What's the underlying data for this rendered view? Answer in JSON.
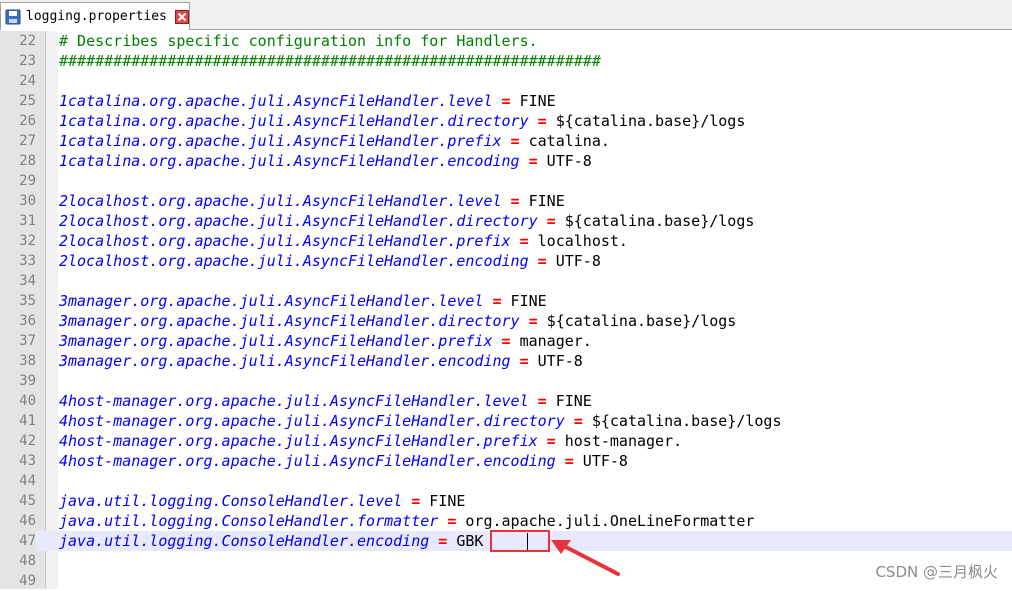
{
  "tab": {
    "label": "logging.properties"
  },
  "lines": [
    {
      "no": "22",
      "segments": [
        {
          "t": "c",
          "text": "# Describes specific configuration info for Handlers."
        }
      ]
    },
    {
      "no": "23",
      "segments": [
        {
          "t": "c",
          "text": "############################################################"
        }
      ]
    },
    {
      "no": "24",
      "segments": []
    },
    {
      "no": "25",
      "segments": [
        {
          "t": "k",
          "text": "1catalina.org.apache.juli.AsyncFileHandler.level"
        },
        {
          "t": "v",
          "text": " "
        },
        {
          "t": "o",
          "text": "="
        },
        {
          "t": "v",
          "text": " FINE"
        }
      ]
    },
    {
      "no": "26",
      "segments": [
        {
          "t": "k",
          "text": "1catalina.org.apache.juli.AsyncFileHandler.directory"
        },
        {
          "t": "v",
          "text": " "
        },
        {
          "t": "o",
          "text": "="
        },
        {
          "t": "v",
          "text": " ${catalina.base}/logs"
        }
      ]
    },
    {
      "no": "27",
      "segments": [
        {
          "t": "k",
          "text": "1catalina.org.apache.juli.AsyncFileHandler.prefix"
        },
        {
          "t": "v",
          "text": " "
        },
        {
          "t": "o",
          "text": "="
        },
        {
          "t": "v",
          "text": " catalina."
        }
      ]
    },
    {
      "no": "28",
      "segments": [
        {
          "t": "k",
          "text": "1catalina.org.apache.juli.AsyncFileHandler.encoding"
        },
        {
          "t": "v",
          "text": " "
        },
        {
          "t": "o",
          "text": "="
        },
        {
          "t": "v",
          "text": " UTF-8"
        }
      ]
    },
    {
      "no": "29",
      "segments": []
    },
    {
      "no": "30",
      "segments": [
        {
          "t": "k",
          "text": "2localhost.org.apache.juli.AsyncFileHandler.level"
        },
        {
          "t": "v",
          "text": " "
        },
        {
          "t": "o",
          "text": "="
        },
        {
          "t": "v",
          "text": " FINE"
        }
      ]
    },
    {
      "no": "31",
      "segments": [
        {
          "t": "k",
          "text": "2localhost.org.apache.juli.AsyncFileHandler.directory"
        },
        {
          "t": "v",
          "text": " "
        },
        {
          "t": "o",
          "text": "="
        },
        {
          "t": "v",
          "text": " ${catalina.base}/logs"
        }
      ]
    },
    {
      "no": "32",
      "segments": [
        {
          "t": "k",
          "text": "2localhost.org.apache.juli.AsyncFileHandler.prefix"
        },
        {
          "t": "v",
          "text": " "
        },
        {
          "t": "o",
          "text": "="
        },
        {
          "t": "v",
          "text": " localhost."
        }
      ]
    },
    {
      "no": "33",
      "segments": [
        {
          "t": "k",
          "text": "2localhost.org.apache.juli.AsyncFileHandler.encoding"
        },
        {
          "t": "v",
          "text": " "
        },
        {
          "t": "o",
          "text": "="
        },
        {
          "t": "v",
          "text": " UTF-8"
        }
      ]
    },
    {
      "no": "34",
      "segments": []
    },
    {
      "no": "35",
      "segments": [
        {
          "t": "k",
          "text": "3manager.org.apache.juli.AsyncFileHandler.level"
        },
        {
          "t": "v",
          "text": " "
        },
        {
          "t": "o",
          "text": "="
        },
        {
          "t": "v",
          "text": " FINE"
        }
      ]
    },
    {
      "no": "36",
      "segments": [
        {
          "t": "k",
          "text": "3manager.org.apache.juli.AsyncFileHandler.directory"
        },
        {
          "t": "v",
          "text": " "
        },
        {
          "t": "o",
          "text": "="
        },
        {
          "t": "v",
          "text": " ${catalina.base}/logs"
        }
      ]
    },
    {
      "no": "37",
      "segments": [
        {
          "t": "k",
          "text": "3manager.org.apache.juli.AsyncFileHandler.prefix"
        },
        {
          "t": "v",
          "text": " "
        },
        {
          "t": "o",
          "text": "="
        },
        {
          "t": "v",
          "text": " manager."
        }
      ]
    },
    {
      "no": "38",
      "segments": [
        {
          "t": "k",
          "text": "3manager.org.apache.juli.AsyncFileHandler.encoding"
        },
        {
          "t": "v",
          "text": " "
        },
        {
          "t": "o",
          "text": "="
        },
        {
          "t": "v",
          "text": " UTF-8"
        }
      ]
    },
    {
      "no": "39",
      "segments": []
    },
    {
      "no": "40",
      "segments": [
        {
          "t": "k",
          "text": "4host-manager.org.apache.juli.AsyncFileHandler.level"
        },
        {
          "t": "v",
          "text": " "
        },
        {
          "t": "o",
          "text": "="
        },
        {
          "t": "v",
          "text": " FINE"
        }
      ]
    },
    {
      "no": "41",
      "segments": [
        {
          "t": "k",
          "text": "4host-manager.org.apache.juli.AsyncFileHandler.directory"
        },
        {
          "t": "v",
          "text": " "
        },
        {
          "t": "o",
          "text": "="
        },
        {
          "t": "v",
          "text": " ${catalina.base}/logs"
        }
      ]
    },
    {
      "no": "42",
      "segments": [
        {
          "t": "k",
          "text": "4host-manager.org.apache.juli.AsyncFileHandler.prefix"
        },
        {
          "t": "v",
          "text": " "
        },
        {
          "t": "o",
          "text": "="
        },
        {
          "t": "v",
          "text": " host-manager."
        }
      ]
    },
    {
      "no": "43",
      "segments": [
        {
          "t": "k",
          "text": "4host-manager.org.apache.juli.AsyncFileHandler.encoding"
        },
        {
          "t": "v",
          "text": " "
        },
        {
          "t": "o",
          "text": "="
        },
        {
          "t": "v",
          "text": " UTF-8"
        }
      ]
    },
    {
      "no": "44",
      "segments": []
    },
    {
      "no": "45",
      "segments": [
        {
          "t": "k",
          "text": "java.util.logging.ConsoleHandler.level"
        },
        {
          "t": "v",
          "text": " "
        },
        {
          "t": "o",
          "text": "="
        },
        {
          "t": "v",
          "text": " FINE"
        }
      ]
    },
    {
      "no": "46",
      "segments": [
        {
          "t": "k",
          "text": "java.util.logging.ConsoleHandler.formatter"
        },
        {
          "t": "v",
          "text": " "
        },
        {
          "t": "o",
          "text": "="
        },
        {
          "t": "v",
          "text": " org.apache.juli.OneLineFormatter"
        }
      ]
    },
    {
      "no": "47",
      "current": true,
      "segments": [
        {
          "t": "k",
          "text": "java.util.logging.ConsoleHandler.encoding"
        },
        {
          "t": "v",
          "text": " "
        },
        {
          "t": "o",
          "text": "="
        },
        {
          "t": "v",
          "text": " GBK"
        }
      ]
    },
    {
      "no": "48",
      "segments": []
    },
    {
      "no": "49",
      "segments": []
    }
  ],
  "watermark": "CSDN @三月枫火",
  "colors": {
    "comment": "#008000",
    "key": "#0000ff",
    "operator": "#ff0000",
    "value": "#000000",
    "current_line": "#e8e8ff",
    "annotation": "#e8333a"
  },
  "icons": {
    "save": "floppy-disk-icon",
    "close": "close-icon",
    "annotation": "arrow-icon"
  }
}
